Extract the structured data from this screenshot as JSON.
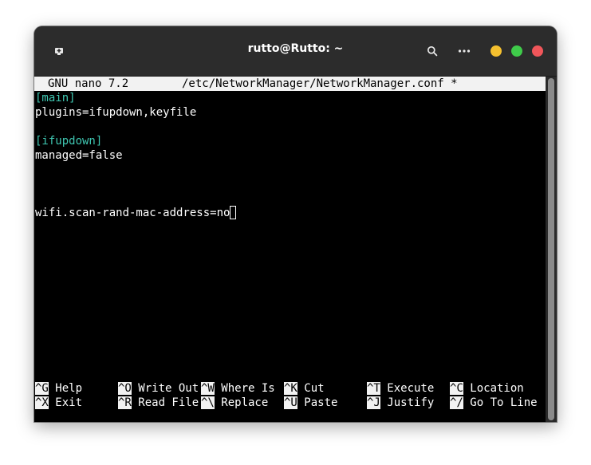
{
  "window": {
    "title": "rutto@Rutto: ~"
  },
  "icons": {
    "new_tab": "new-tab-icon",
    "search": "search-icon",
    "menu": "more-icon"
  },
  "colors": {
    "minimize": "#f5c02f",
    "maximize": "#3fcb4a",
    "close": "#f0565a",
    "section": "#3fc7b2"
  },
  "nano": {
    "version": "GNU nano 7.2",
    "file": "/etc/NetworkManager/NetworkManager.conf *",
    "lines": [
      {
        "text": "[main]",
        "type": "section"
      },
      {
        "text": "plugins=ifupdown,keyfile",
        "type": "text"
      },
      {
        "text": "",
        "type": "text"
      },
      {
        "text": "[ifupdown]",
        "type": "section"
      },
      {
        "text": "managed=false",
        "type": "text"
      },
      {
        "text": "",
        "type": "text"
      },
      {
        "text": "",
        "type": "text"
      },
      {
        "text": "",
        "type": "text"
      },
      {
        "text": "wifi.scan-rand-mac-address=no",
        "type": "text"
      }
    ],
    "shortcuts_row1": [
      {
        "key": "^G",
        "label": "Help"
      },
      {
        "key": "^O",
        "label": "Write Out"
      },
      {
        "key": "^W",
        "label": "Where Is"
      },
      {
        "key": "^K",
        "label": "Cut"
      },
      {
        "key": "^T",
        "label": "Execute"
      },
      {
        "key": "^C",
        "label": "Location"
      }
    ],
    "shortcuts_row2": [
      {
        "key": "^X",
        "label": "Exit"
      },
      {
        "key": "^R",
        "label": "Read File"
      },
      {
        "key": "^\\",
        "label": "Replace"
      },
      {
        "key": "^U",
        "label": "Paste"
      },
      {
        "key": "^J",
        "label": "Justify"
      },
      {
        "key": "^/",
        "label": "Go To Line"
      }
    ]
  }
}
